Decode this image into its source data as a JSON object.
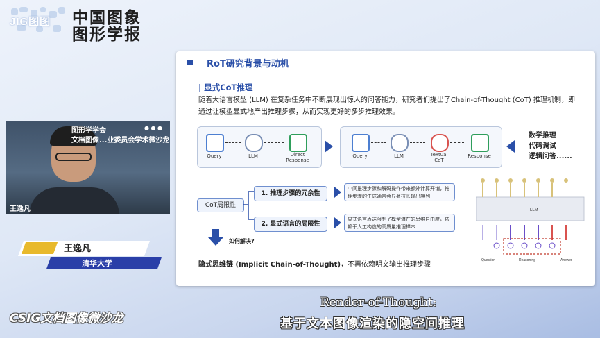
{
  "header": {
    "logo_text": "JIG图图",
    "title_line1": "中国图象",
    "title_line2": "图形学报"
  },
  "slide": {
    "title": "RoT研究背景与动机",
    "section_title": "| 显式CoT推理",
    "intro_text": "随着大语言模型 (LLM) 在复杂任务中不断展现出惊人的问答能力，研究者们提出了Chain-of-Thought (CoT) 推理机制，即通过让模型显式地产出推理步骤，从而实现更好的多步推理效果。",
    "flow_left": {
      "query": "Query",
      "llm": "LLM",
      "direct": "Direct Response"
    },
    "flow_right": {
      "query": "Query",
      "llm": "LLM",
      "textual_cot": "Textual CoT",
      "response": "Response"
    },
    "skills": [
      "数学推理",
      "代码调试",
      "逻辑问答......"
    ],
    "cot_limit_label": "CoT局限性",
    "limit1": "1. 推理步骤的冗余性",
    "limit2": "2. 显式语言的局限性",
    "desc1": "中间推理步骤和解码操作带来额外计算开销，推理步骤的生成通常会显著拉长输出序列",
    "desc2": "显式语言表达限制了模型潜在的思维自由度，依赖于人工构造的高质量推理样本",
    "howto": "如何解决?",
    "implicit_bold": "隐式思维链 (Implicit Chain-of-Thought)",
    "implicit_rest": "，不再依赖明文输出推理步骤",
    "diagram": {
      "llm_label": "LLM",
      "question": "Question",
      "reasoning": "Reasoning",
      "answer": "Answer"
    }
  },
  "speaker": {
    "cam_banner": "图形学学会\n文档图像...业委员会学术微沙龙",
    "cam_name": "王逸凡",
    "name": "王逸凡",
    "affiliation": "清华大学"
  },
  "event": {
    "salon": "CSIG文档图像微沙龙",
    "talk_title_line1": "Render-of-Thought:",
    "talk_title_line2": "基于文本图像渲染的隐空间推理"
  },
  "colors": {
    "accent": "#2a4fa8",
    "gold": "#e8b92c"
  }
}
